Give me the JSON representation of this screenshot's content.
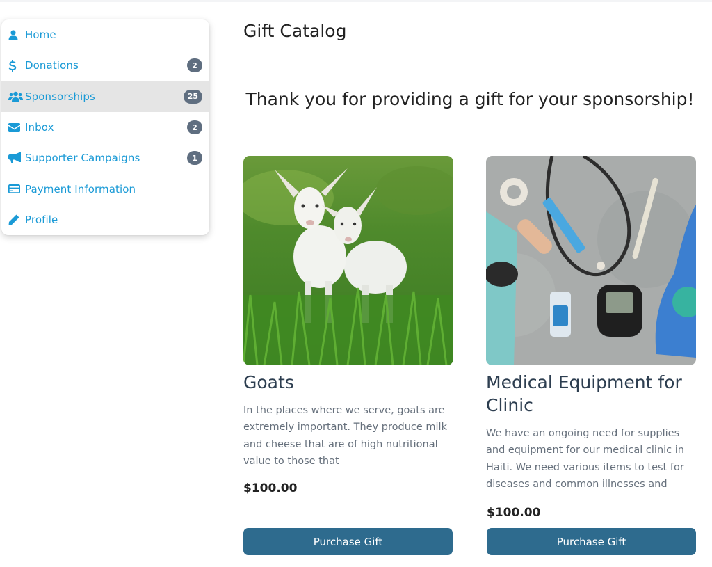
{
  "sidebar": {
    "items": [
      {
        "label": "Home",
        "icon": "user-icon",
        "badge": null
      },
      {
        "label": "Donations",
        "icon": "dollar-icon",
        "badge": "2"
      },
      {
        "label": "Sponsorships",
        "icon": "users-icon",
        "badge": "25",
        "active": true
      },
      {
        "label": "Inbox",
        "icon": "envelope-icon",
        "badge": "2"
      },
      {
        "label": "Supporter Campaigns",
        "icon": "megaphone-icon",
        "badge": "1"
      },
      {
        "label": "Payment Information",
        "icon": "credit-card-icon",
        "badge": null
      },
      {
        "label": "Profile",
        "icon": "pencil-icon",
        "badge": null
      }
    ]
  },
  "main": {
    "title": "Gift Catalog",
    "thanks": "Thank you for providing a gift for your sponsorship!",
    "gifts": [
      {
        "title": "Goats",
        "description": "In the places where we serve, goats are extremely important. They produce milk and cheese that are of high nutritional value to those that",
        "price": "$100.00",
        "button": "Purchase Gift",
        "image": "goats-photo"
      },
      {
        "title": "Medical Equipment for Clinic",
        "description": "We have an ongoing need for supplies and equipment for our medical clinic in Haiti. We need various items to test for diseases and common illnesses and",
        "price": "$100.00",
        "button": "Purchase Gift",
        "image": "medical-supplies-photo"
      }
    ]
  },
  "colors": {
    "accent": "#1a9ad6",
    "button": "#2e6b8e",
    "badge": "#5f6e80",
    "active_item": "#e5e5e5"
  }
}
